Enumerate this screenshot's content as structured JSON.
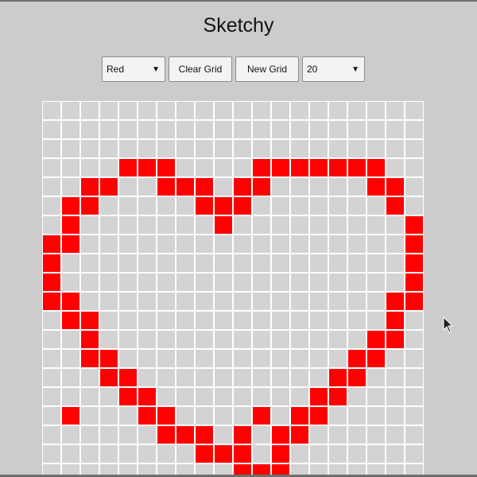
{
  "app": {
    "title": "Sketchy"
  },
  "controls": {
    "color_select": {
      "value": "Red"
    },
    "clear_button": "Clear Grid",
    "new_grid_button": "New Grid",
    "size_select": {
      "value": "20"
    }
  },
  "grid": {
    "rows": 20,
    "cols": 20,
    "cell_color": "#d3d3d3",
    "paint_color": "#ff0000",
    "line_color": "#ffffff",
    "painted": [
      [
        3,
        4
      ],
      [
        3,
        5
      ],
      [
        3,
        6
      ],
      [
        3,
        11
      ],
      [
        3,
        12
      ],
      [
        3,
        13
      ],
      [
        3,
        14
      ],
      [
        3,
        15
      ],
      [
        3,
        16
      ],
      [
        3,
        17
      ],
      [
        4,
        2
      ],
      [
        4,
        3
      ],
      [
        4,
        6
      ],
      [
        4,
        7
      ],
      [
        4,
        8
      ],
      [
        4,
        10
      ],
      [
        4,
        11
      ],
      [
        4,
        17
      ],
      [
        4,
        18
      ],
      [
        5,
        1
      ],
      [
        5,
        2
      ],
      [
        5,
        8
      ],
      [
        5,
        9
      ],
      [
        5,
        10
      ],
      [
        5,
        18
      ],
      [
        6,
        1
      ],
      [
        6,
        9
      ],
      [
        6,
        19
      ],
      [
        7,
        0
      ],
      [
        7,
        1
      ],
      [
        7,
        19
      ],
      [
        8,
        0
      ],
      [
        8,
        19
      ],
      [
        9,
        0
      ],
      [
        9,
        19
      ],
      [
        10,
        0
      ],
      [
        10,
        1
      ],
      [
        10,
        18
      ],
      [
        10,
        19
      ],
      [
        11,
        1
      ],
      [
        11,
        2
      ],
      [
        11,
        18
      ],
      [
        12,
        2
      ],
      [
        12,
        17
      ],
      [
        12,
        18
      ],
      [
        13,
        2
      ],
      [
        13,
        3
      ],
      [
        13,
        16
      ],
      [
        13,
        17
      ],
      [
        14,
        3
      ],
      [
        14,
        4
      ],
      [
        14,
        15
      ],
      [
        14,
        16
      ],
      [
        15,
        4
      ],
      [
        15,
        5
      ],
      [
        15,
        14
      ],
      [
        15,
        15
      ],
      [
        16,
        1
      ],
      [
        16,
        5
      ],
      [
        16,
        6
      ],
      [
        16,
        11
      ],
      [
        16,
        13
      ],
      [
        16,
        14
      ],
      [
        17,
        6
      ],
      [
        17,
        7
      ],
      [
        17,
        8
      ],
      [
        17,
        10
      ],
      [
        17,
        12
      ],
      [
        17,
        13
      ],
      [
        18,
        8
      ],
      [
        18,
        9
      ],
      [
        18,
        10
      ],
      [
        18,
        12
      ],
      [
        19,
        10
      ],
      [
        19,
        11
      ],
      [
        19,
        12
      ]
    ]
  }
}
